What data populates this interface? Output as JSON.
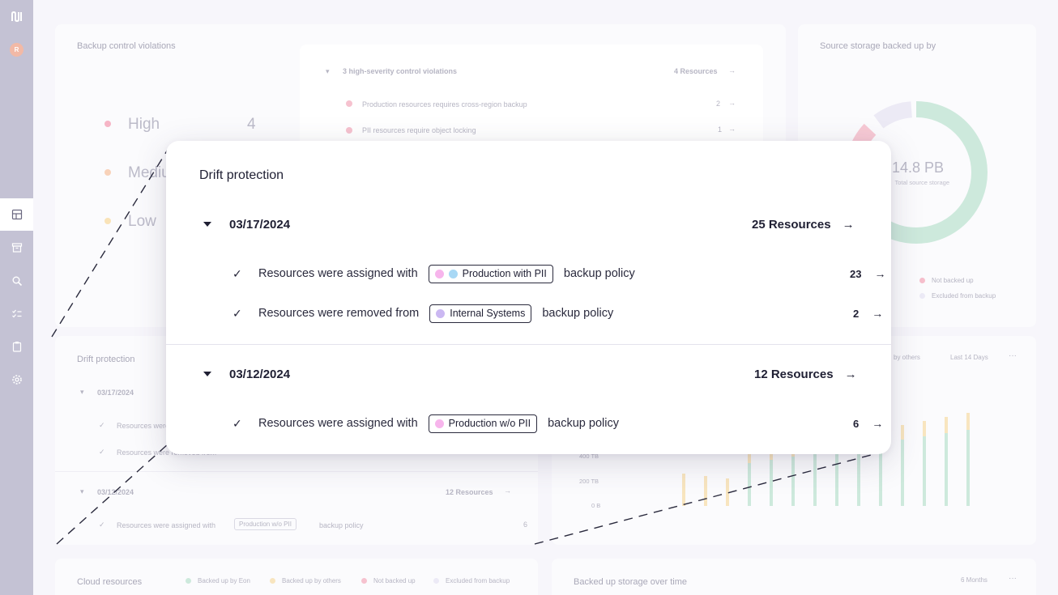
{
  "sidebar": {
    "logo_label": "N",
    "avatar_initial": "R",
    "nav_items": [
      "dashboard-icon",
      "archive-icon",
      "search-icon",
      "checklist-icon",
      "clipboard-icon",
      "settings-icon"
    ]
  },
  "background": {
    "violations": {
      "title": "Backup control violations",
      "levels": [
        {
          "label": "High",
          "count": "4",
          "color": "#f29ab0"
        },
        {
          "label": "Medium",
          "color": "#f5c3a0"
        },
        {
          "label": "Low",
          "color": "#f7dea3"
        }
      ],
      "group_title": "3 high-severity control violations",
      "group_count": "4 Resources",
      "items": [
        {
          "text": "Production resources requires cross-region backup",
          "count": "2"
        },
        {
          "text": "PII resources require object locking",
          "count": "1"
        }
      ]
    },
    "storage": {
      "title": "Source storage backed up by",
      "total": "14.8 PB",
      "total_label": "Total source storage",
      "legend": [
        {
          "label": "Not backed up",
          "color": "#f29ab0"
        },
        {
          "label": "Excluded from backup",
          "color": "#e5e3f4"
        }
      ]
    },
    "drift": {
      "title": "Drift protection",
      "groups": [
        {
          "date": "03/17/2024",
          "rows": [
            "Resources were assigned with",
            "Resources were removed from"
          ]
        },
        {
          "date": "03/12/2024",
          "count": "12 Resources",
          "rows": [
            {
              "text": "Resources were assigned with",
              "tag": "Production w/o PII",
              "suffix": "backup policy",
              "count": "6"
            }
          ]
        }
      ]
    },
    "chart_panel": {
      "legend_tail": "by others",
      "range": "Last 14 Days",
      "y_ticks": [
        "400 TB",
        "200 TB",
        "0 B"
      ]
    },
    "cloud": {
      "title": "Cloud resources",
      "legend": [
        {
          "label": "Backed up by Eon",
          "color": "#9fd6bf"
        },
        {
          "label": "Backed up by others",
          "color": "#f5d898"
        },
        {
          "label": "Not backed up",
          "color": "#f29ab0"
        },
        {
          "label": "Excluded from backup",
          "color": "#e5e3f4"
        }
      ]
    },
    "storage_time": {
      "title": "Backed up storage over time",
      "range": "6 Months"
    }
  },
  "modal": {
    "title": "Drift protection",
    "groups": [
      {
        "date": "03/17/2024",
        "count": "25 Resources",
        "rows": [
          {
            "text": "Resources were assigned with",
            "tag": "Production with PII",
            "tag_colors": [
              "#f7b5ec",
              "#a8d8f5"
            ],
            "suffix": "backup policy",
            "count": "23"
          },
          {
            "text": "Resources were removed from",
            "tag": "Internal Systems",
            "tag_colors": [
              "#cbb8f2"
            ],
            "suffix": "backup policy",
            "count": "2"
          }
        ]
      },
      {
        "date": "03/12/2024",
        "count": "12 Resources",
        "rows": [
          {
            "text": "Resources were assigned with",
            "tag": "Production w/o PII",
            "tag_colors": [
              "#f7b5ec"
            ],
            "suffix": "backup policy",
            "count": "6"
          }
        ]
      }
    ],
    "arrow": "→",
    "check": "✓"
  }
}
